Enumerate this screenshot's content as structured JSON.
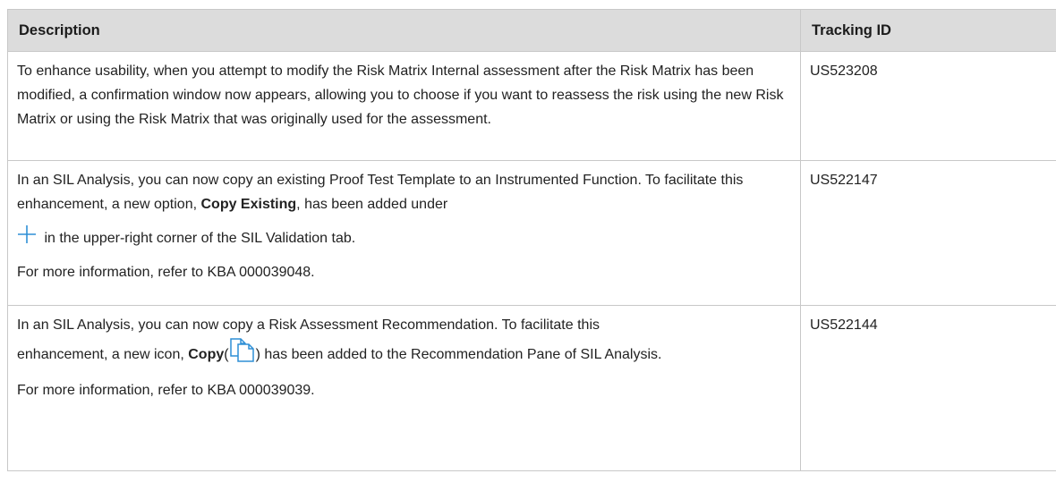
{
  "table": {
    "headers": {
      "description": "Description",
      "tracking_id": "Tracking ID"
    },
    "rows": [
      {
        "description": "To enhance usability, when you attempt to modify the Risk Matrix Internal assessment after the Risk Matrix has been modified, a confirmation window now appears, allowing you to choose if you want to reassess the risk using the new Risk Matrix or using the Risk Matrix that was originally used for the assessment.",
        "tracking_id": "US523208"
      },
      {
        "p1_before": "In an SIL Analysis, you can now copy an existing Proof Test Template to an Instrumented Function. To facilitate this enhancement, a new option, ",
        "p1_bold": "Copy Existing",
        "p1_after": ", has been added under",
        "p2_icon": "plus-icon",
        "p2_text": " in the upper-right corner of the SIL Validation tab.",
        "p3": "For more information, refer to KBA 000039048.",
        "tracking_id": "US522147"
      },
      {
        "p1_line1": "In an SIL Analysis, you can now copy a Risk Assessment Recommendation. To facilitate this",
        "p1_line2_before": "enhancement, a new icon, ",
        "p1_bold": "Copy",
        "p1_icon_open": "(",
        "p1_icon": "copy-icon",
        "p1_after": ") has been added to the Recommendation Pane of SIL Analysis.",
        "p2": "For more information, refer to KBA 000039039.",
        "tracking_id": "US522144"
      }
    ]
  },
  "colors": {
    "header_bg": "#dcdcdc",
    "border": "#c8c8c8",
    "icon_blue": "#2e8fd6"
  }
}
